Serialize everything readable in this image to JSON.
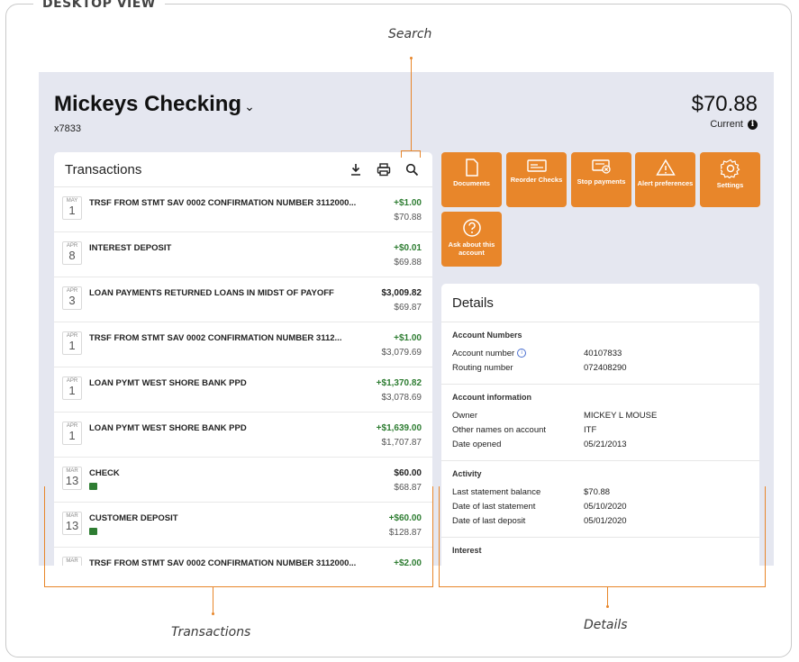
{
  "frame": {
    "label": "DESKTOP VIEW"
  },
  "annotations": {
    "search": "Search",
    "transactions": "Transactions",
    "details": "Details"
  },
  "account": {
    "name": "Mickeys Checking",
    "number": "x7833",
    "balance": "$70.88",
    "balance_label": "Current"
  },
  "transactions": {
    "title": "Transactions",
    "tools": [
      "download-icon",
      "print-icon",
      "search-icon"
    ],
    "rows": [
      {
        "month": "MAY",
        "day": "1",
        "desc": "TRSF FROM STMT SAV 0002 CONFIRMATION NUMBER 3112000...",
        "amount": "+$1.00",
        "balance": "$70.88",
        "credit": true,
        "check": false
      },
      {
        "month": "APR",
        "day": "8",
        "desc": "INTEREST DEPOSIT",
        "amount": "+$0.01",
        "balance": "$69.88",
        "credit": true,
        "check": false
      },
      {
        "month": "APR",
        "day": "3",
        "desc": "LOAN PAYMENTS RETURNED LOANS IN MIDST OF PAYOFF",
        "amount": "$3,009.82",
        "balance": "$69.87",
        "credit": false,
        "check": false
      },
      {
        "month": "APR",
        "day": "1",
        "desc": "TRSF FROM STMT SAV 0002 CONFIRMATION NUMBER 3112...",
        "amount": "+$1.00",
        "balance": "$3,079.69",
        "credit": true,
        "check": false
      },
      {
        "month": "APR",
        "day": "1",
        "desc": "LOAN PYMT WEST SHORE BANK PPD",
        "amount": "+$1,370.82",
        "balance": "$3,078.69",
        "credit": true,
        "check": false
      },
      {
        "month": "APR",
        "day": "1",
        "desc": "LOAN PYMT WEST SHORE BANK PPD",
        "amount": "+$1,639.00",
        "balance": "$1,707.87",
        "credit": true,
        "check": false
      },
      {
        "month": "MAR",
        "day": "13",
        "desc": "CHECK",
        "amount": "$60.00",
        "balance": "$68.87",
        "credit": false,
        "check": true
      },
      {
        "month": "MAR",
        "day": "13",
        "desc": "CUSTOMER DEPOSIT",
        "amount": "+$60.00",
        "balance": "$128.87",
        "credit": true,
        "check": true
      },
      {
        "month": "MAR",
        "day": "",
        "desc": "TRSF FROM STMT SAV 0002 CONFIRMATION NUMBER 3112000...",
        "amount": "+$2.00",
        "balance": "",
        "credit": true,
        "check": false
      }
    ]
  },
  "actions": [
    {
      "name": "documents",
      "label": "Documents",
      "icon": "document-icon"
    },
    {
      "name": "reorder-checks",
      "label": "Reorder Checks",
      "icon": "check-icon"
    },
    {
      "name": "stop-payments",
      "label": "Stop payments",
      "icon": "stop-payment-icon"
    },
    {
      "name": "alert-preferences",
      "label": "Alert preferences",
      "icon": "alert-icon"
    },
    {
      "name": "settings",
      "label": "Settings",
      "icon": "gear-icon"
    },
    {
      "name": "ask-about-account",
      "label": "Ask about this account",
      "icon": "question-icon"
    }
  ],
  "details": {
    "title": "Details",
    "sections": [
      {
        "title": "Account Numbers",
        "rows": [
          {
            "k": "Account number",
            "v": "40107833",
            "info": true
          },
          {
            "k": "Routing number",
            "v": "072408290"
          }
        ]
      },
      {
        "title": "Account information",
        "rows": [
          {
            "k": "Owner",
            "v": "MICKEY L MOUSE"
          },
          {
            "k": "Other names on account",
            "v": "ITF"
          },
          {
            "k": "Date opened",
            "v": "05/21/2013"
          }
        ]
      },
      {
        "title": "Activity",
        "rows": [
          {
            "k": "Last statement balance",
            "v": "$70.88"
          },
          {
            "k": "Date of last statement",
            "v": "05/10/2020"
          },
          {
            "k": "Date of last deposit",
            "v": "05/01/2020"
          }
        ]
      },
      {
        "title": "Interest",
        "rows": []
      }
    ]
  },
  "colors": {
    "accent": "#e8862a",
    "credit": "#2e7d32",
    "screen_bg": "#e5e7f0"
  }
}
